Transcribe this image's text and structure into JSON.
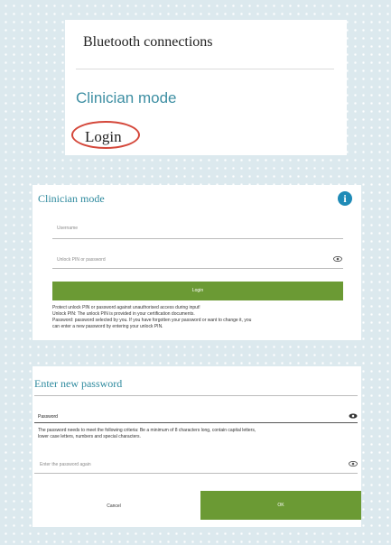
{
  "panel1": {
    "bluetooth_label": "Bluetooth connections",
    "clinician_label": "Clinician mode",
    "login_label": "Login",
    "highlight_color": "#d4473a"
  },
  "panel2": {
    "title": "Clinician mode",
    "info_icon": "info-icon",
    "username_placeholder": "Username",
    "pin_placeholder": "Unlock PIN or password",
    "login_button": "Login",
    "notes": [
      "Protect unlock PIN or password against unauthorised access during input!",
      "Unlock PIN: The unlock PIN is provided in your certification documents.",
      "Password: password selected by you. If you have forgotten your password or want to change it, you",
      "can enter a new password by entering your unlock PIN."
    ]
  },
  "panel3": {
    "title": "Enter new password",
    "password_label": "Password",
    "criteria": [
      "The password needs to meet the following criteria: Be a minimum of 8 characters long, contain capital letters,",
      "lower case letters, numbers and special characters."
    ],
    "repeat_placeholder": "Enter the password again",
    "cancel_button": "Cancel",
    "ok_button": "OK"
  },
  "colors": {
    "accent_teal": "#2e8a9e",
    "button_green": "#6b9a34",
    "info_blue": "#1f8bb7",
    "background": "#dce9ee"
  }
}
